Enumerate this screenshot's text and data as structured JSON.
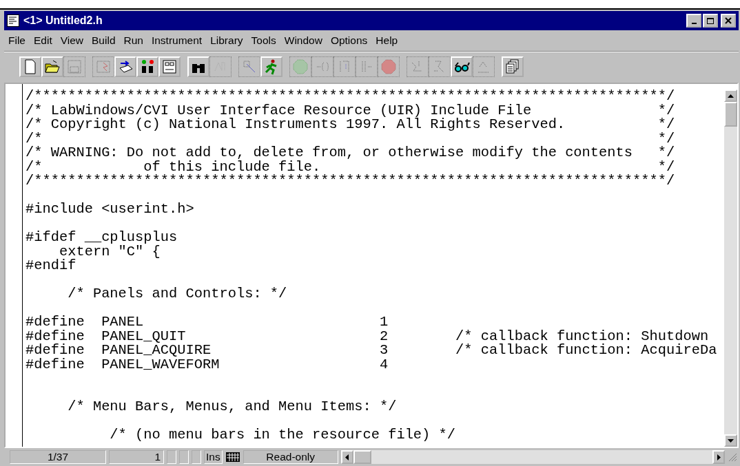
{
  "window": {
    "title": "<1> Untitled2.h"
  },
  "menu": [
    {
      "label": "File"
    },
    {
      "label": "Edit"
    },
    {
      "label": "View"
    },
    {
      "label": "Build"
    },
    {
      "label": "Run"
    },
    {
      "label": "Instrument"
    },
    {
      "label": "Library"
    },
    {
      "label": "Tools"
    },
    {
      "label": "Window"
    },
    {
      "label": "Options"
    },
    {
      "label": "Help"
    }
  ],
  "toolbar": [
    [
      {
        "disabled": false
      },
      {
        "disabled": false
      },
      {
        "disabled": true
      }
    ],
    [
      {
        "disabled": true
      },
      {
        "disabled": false
      },
      {
        "disabled": false
      },
      {
        "disabled": false
      }
    ],
    [
      {
        "disabled": false
      },
      {
        "disabled": true
      }
    ],
    [
      {
        "disabled": true
      },
      {
        "disabled": false
      }
    ],
    [
      {
        "disabled": true
      },
      {
        "disabled": true
      },
      {
        "disabled": true
      },
      {
        "disabled": true
      },
      {
        "disabled": true
      }
    ],
    [
      {
        "disabled": true
      },
      {
        "disabled": true
      },
      {
        "disabled": false
      },
      {
        "disabled": true
      }
    ],
    [
      {
        "disabled": false
      }
    ]
  ],
  "code_lines": [
    {
      "kind": "code",
      "text": "/***************************************************************************/"
    },
    {
      "kind": "code",
      "text": "/* LabWindows/CVI User Interface Resource (UIR) Include File               */"
    },
    {
      "kind": "code",
      "text": "/* Copyright (c) National Instruments 1997. All Rights Reserved.           */"
    },
    {
      "kind": "code",
      "text": "/*                                                                         */"
    },
    {
      "kind": "code",
      "text": "/* WARNING: Do not add to, delete from, or otherwise modify the contents   */"
    },
    {
      "kind": "code",
      "text": "/*            of this include file.                                        */"
    },
    {
      "kind": "code",
      "text": "/***************************************************************************/"
    },
    {
      "kind": "blank"
    },
    {
      "kind": "code",
      "text": "#include <userint.h>"
    },
    {
      "kind": "blank"
    },
    {
      "kind": "code",
      "text": "#ifdef __cplusplus"
    },
    {
      "kind": "code",
      "text": "    extern \"C\" {"
    },
    {
      "kind": "code",
      "text": "#endif"
    },
    {
      "kind": "blank"
    },
    {
      "kind": "code",
      "text": "     /* Panels and Controls: */"
    },
    {
      "kind": "blank"
    },
    {
      "kind": "code",
      "text": "#define  PANEL                            1"
    },
    {
      "kind": "code",
      "text": "#define  PANEL_QUIT                       2        /* callback function: Shutdown"
    },
    {
      "kind": "code",
      "text": "#define  PANEL_ACQUIRE                    3        /* callback function: AcquireDa"
    },
    {
      "kind": "code",
      "text": "#define  PANEL_WAVEFORM                   4"
    },
    {
      "kind": "blank"
    },
    {
      "kind": "blank"
    },
    {
      "kind": "code",
      "text": "     /* Menu Bars, Menus, and Menu Items: */"
    },
    {
      "kind": "blank"
    },
    {
      "kind": "code",
      "text": "          /* (no menu bars in the resource file) */"
    }
  ],
  "status_bar": {
    "position": "1/37",
    "column": "1",
    "insert_mode": "Ins",
    "mode": "Read-only"
  }
}
